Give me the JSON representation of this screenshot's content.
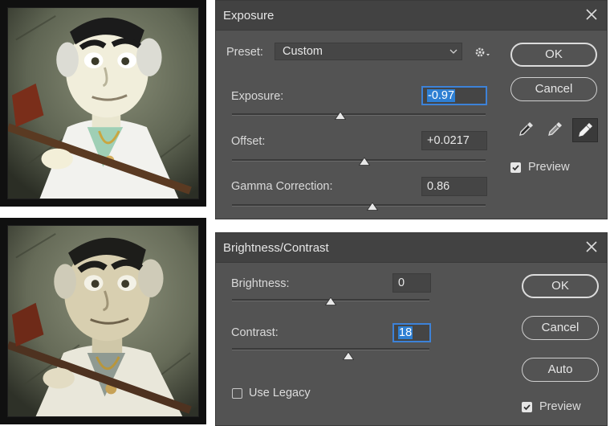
{
  "exposure_dialog": {
    "title": "Exposure",
    "preset_label": "Preset:",
    "preset_value": "Custom",
    "exposure_label": "Exposure:",
    "exposure_value": "-0.97",
    "exposure_slider": 0.42,
    "offset_label": "Offset:",
    "offset_value": "+0.0217",
    "offset_slider": 0.52,
    "gamma_label": "Gamma Correction:",
    "gamma_value": "0.86",
    "gamma_slider": 0.55,
    "ok_label": "OK",
    "cancel_label": "Cancel",
    "preview_label": "Preview",
    "preview_checked": true,
    "icons": [
      "gear-icon",
      "eyedropper-black-icon",
      "eyedropper-gray-icon",
      "eyedropper-white-icon"
    ]
  },
  "brightness_dialog": {
    "title": "Brightness/Contrast",
    "brightness_label": "Brightness:",
    "brightness_value": "0",
    "brightness_slider": 0.5,
    "contrast_label": "Contrast:",
    "contrast_value": "18",
    "contrast_slider": 0.59,
    "ok_label": "OK",
    "cancel_label": "Cancel",
    "auto_label": "Auto",
    "legacy_label": "Use Legacy",
    "legacy_checked": false,
    "preview_label": "Preview",
    "preview_checked": true
  },
  "colors": {
    "dialog_bg": "#535353",
    "titlebar_bg": "#424242",
    "focus_blue": "#3d82d8",
    "selection_blue": "#2e7fd3"
  }
}
